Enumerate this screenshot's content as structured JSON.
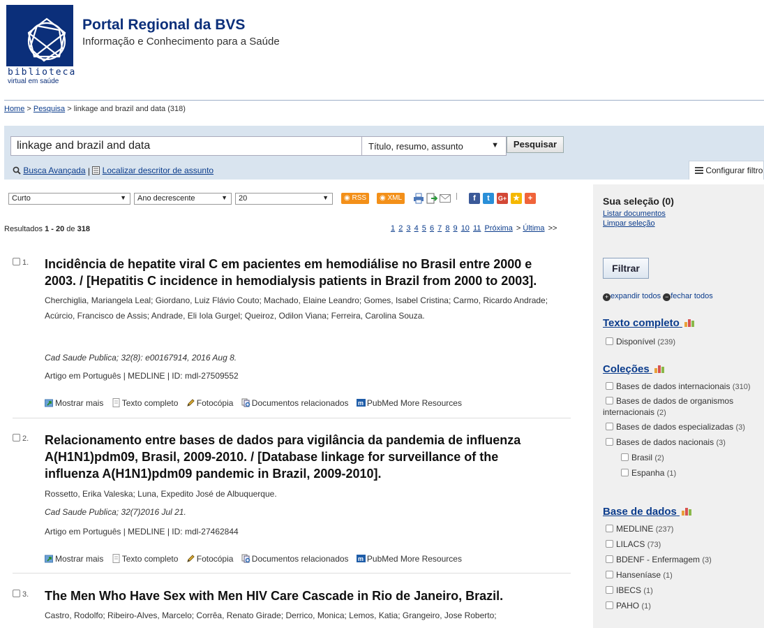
{
  "header": {
    "logo_top": "bvs",
    "logo_line1": "biblioteca",
    "logo_line2": "virtual em saúde",
    "title": "Portal Regional da BVS",
    "subtitle": "Informação e Conhecimento para a Saúde"
  },
  "breadcrumb": {
    "home": "Home",
    "sep1": " > ",
    "search": "Pesquisa",
    "current": " > linkage and brazil and data (318)"
  },
  "search": {
    "query": "linkage and brazil and data",
    "field": "Título, resumo, assunto",
    "button": "Pesquisar",
    "advanced": "Busca Avançada",
    "divider": " | ",
    "descriptor": "Localizar descritor de assunto",
    "config_filters": "Configurar filtros"
  },
  "toolbar": {
    "format": "Curto",
    "sort": "Ano decrescente",
    "per_page": "20",
    "rss": "RSS",
    "xml": "XML"
  },
  "results_summary": {
    "prefix": "Resultados ",
    "range": "1 - 20",
    "of": " de ",
    "total": "318"
  },
  "pager": {
    "pages": [
      "1",
      "2",
      "3",
      "4",
      "5",
      "6",
      "7",
      "8",
      "9",
      "10",
      "11"
    ],
    "next": "Próxima",
    "next_sep": " > ",
    "last": "Última",
    "last_sep": " >>"
  },
  "actions": {
    "more": "Mostrar mais",
    "fulltext": "Texto completo",
    "photocopy": "Fotocópia",
    "related": "Documentos relacionados",
    "pubmed": "PubMed More Resources"
  },
  "results": [
    {
      "num": "1.",
      "title": "Incidência de hepatite viral C em pacientes em hemodiálise no Brasil entre 2000 e 2003. / [Hepatitis C incidence in hemodialysis patients in Brazil from 2000 to 2003].",
      "authors": "Cherchiglia, Mariangela Leal; Giordano, Luiz Flávio Couto; Machado, Elaine Leandro; Gomes, Isabel Cristina; Carmo, Ricardo Andrade; Acúrcio, Francisco de Assis; Andrade, Eli Iola Gurgel; Queiroz, Odilon Viana; Ferreira, Carolina Souza.",
      "source": "Cad Saude Publica; 32(8): e00167914, 2016 Aug 8.",
      "meta": "Artigo em Português | MEDLINE | ID: mdl-27509552"
    },
    {
      "num": "2.",
      "title": "Relacionamento entre bases de dados para vigilância da pandemia de influenza A(H1N1)pdm09, Brasil, 2009-2010. / [Database linkage for surveillance of the influenza A(H1N1)pdm09 pandemic in Brazil, 2009-2010].",
      "authors": "Rossetto, Erika Valeska; Luna, Expedito José de Albuquerque.",
      "source": "Cad Saude Publica; 32(7)2016 Jul 21.",
      "meta": "Artigo em Português | MEDLINE | ID: mdl-27462844"
    },
    {
      "num": "3.",
      "title": "The Men Who Have Sex with Men HIV Care Cascade in Rio de Janeiro, Brazil.",
      "authors": "Castro, Rodolfo; Ribeiro-Alves, Marcelo; Corrêa, Renato Girade; Derrico, Monica; Lemos, Katia; Grangeiro, Jose Roberto;"
    }
  ],
  "sidebar": {
    "selection_title": "Sua seleção (0)",
    "list_docs": "Listar documentos",
    "clear_selection": "Limpar seleção",
    "filter_button": "Filtrar",
    "expand_all": "expandir todos",
    "collapse_all": "fechar todos",
    "groups": {
      "fulltext": {
        "title": "Texto completo",
        "items": [
          {
            "label": "Disponível",
            "count": "(239)"
          }
        ]
      },
      "collections": {
        "title": "Coleções",
        "items": [
          {
            "label": "Bases de dados internacionais",
            "count": "(310)"
          },
          {
            "label": "Bases de dados de organismos",
            "label2": "internacionais",
            "count": "(2)"
          },
          {
            "label": "Bases de dados especializadas",
            "count": "(3)"
          },
          {
            "label": "Bases de dados nacionais",
            "count": "(3)"
          },
          {
            "label": "Brasil",
            "count": "(2)"
          },
          {
            "label": "Espanha",
            "count": "(1)"
          }
        ]
      },
      "databases": {
        "title": "Base de dados",
        "items": [
          {
            "label": "MEDLINE",
            "count": "(237)"
          },
          {
            "label": "LILACS",
            "count": "(73)"
          },
          {
            "label": "BDENF - Enfermagem",
            "count": "(3)"
          },
          {
            "label": "Hanseníase",
            "count": "(1)"
          },
          {
            "label": "IBECS",
            "count": "(1)"
          },
          {
            "label": "PAHO",
            "count": "(1)"
          }
        ]
      }
    }
  }
}
